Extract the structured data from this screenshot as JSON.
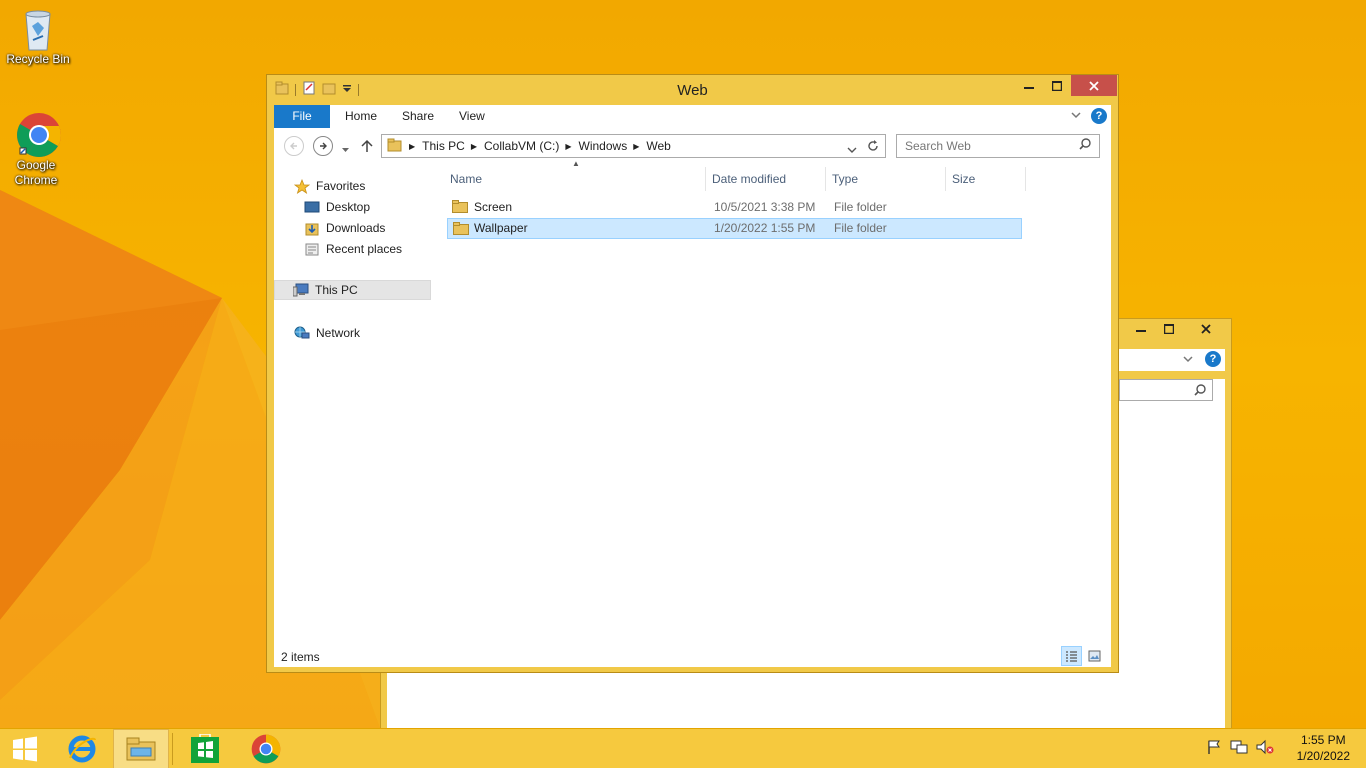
{
  "desktop": {
    "icons": [
      {
        "label": "Recycle Bin",
        "icon": "recycle-bin-icon"
      },
      {
        "label": "Google Chrome",
        "icon": "chrome-icon"
      }
    ]
  },
  "window": {
    "title": "Web",
    "controls": {
      "minimize": "—",
      "maximize": "☐",
      "close": "X"
    },
    "ribbon_tabs": [
      "File",
      "Home",
      "Share",
      "View"
    ],
    "address": {
      "crumbs": [
        "This PC",
        "CollabVM (C:)",
        "Windows",
        "Web"
      ]
    },
    "search": {
      "placeholder": "Search Web"
    },
    "nav": {
      "favorites": "Favorites",
      "desktop": "Desktop",
      "downloads": "Downloads",
      "recent": "Recent places",
      "this_pc": "This PC",
      "network": "Network"
    },
    "columns": [
      "Name",
      "Date modified",
      "Type",
      "Size"
    ],
    "files": [
      {
        "name": "Screen",
        "date": "10/5/2021 3:38 PM",
        "type": "File folder",
        "size": ""
      },
      {
        "name": "Wallpaper",
        "date": "1/20/2022 1:55 PM",
        "type": "File folder",
        "size": ""
      }
    ],
    "status": "2 items"
  },
  "taskbar": {
    "time": "1:55 PM",
    "date": "1/20/2022"
  },
  "colors": {
    "accent": "#1979ca",
    "selection": "#cce8ff",
    "frame": "#f1c948"
  }
}
